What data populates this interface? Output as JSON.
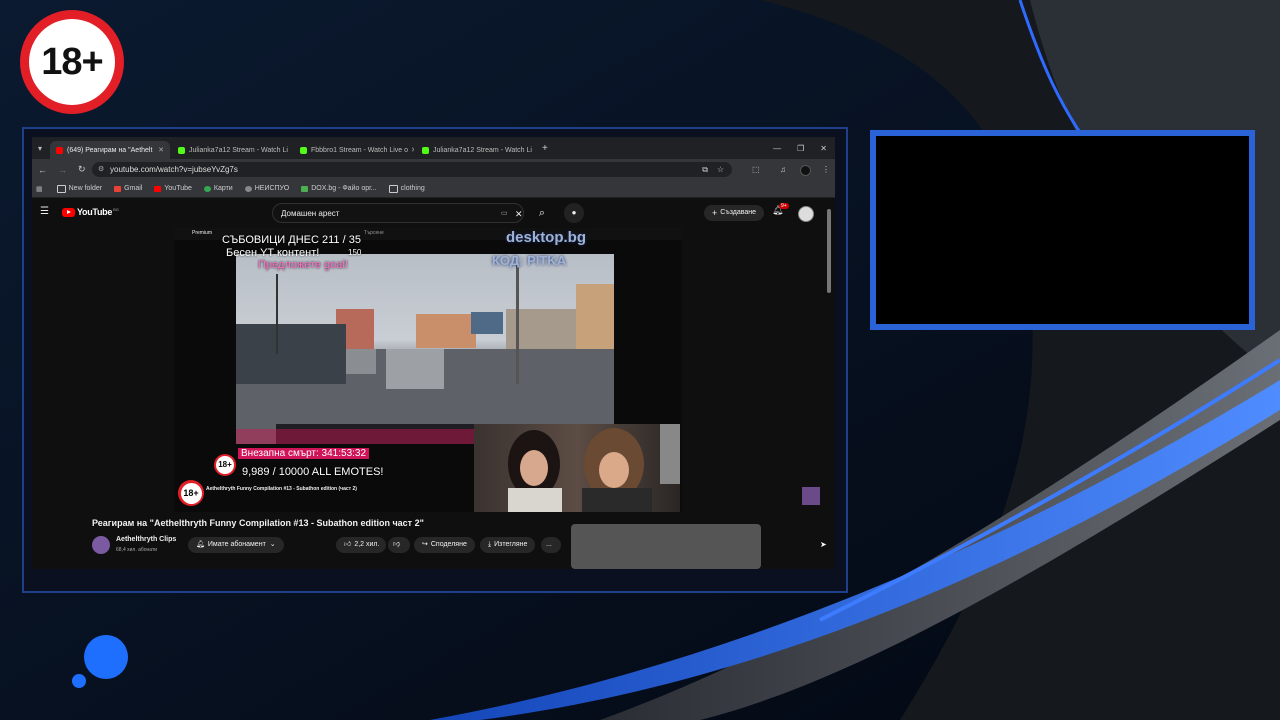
{
  "overlay": {
    "age_badge": "18+"
  },
  "browser": {
    "tabs": [
      {
        "label": "(649) Реагирам на \"Aethelt",
        "active": true,
        "color": "#ff0000"
      },
      {
        "label": "Julianka7a12 Stream - Watch Li",
        "active": false,
        "color": "#53fc18"
      },
      {
        "label": "Fbbbro1 Stream - Watch Live o",
        "active": false,
        "color": "#53fc18"
      },
      {
        "label": "Julianka7a12 Stream - Watch Li",
        "active": false,
        "color": "#53fc18"
      }
    ],
    "url": "youtube.com/watch?v=jubseYvZg7s",
    "bookmarks": [
      "New folder",
      "Gmail",
      "YouTube",
      "Карти",
      "НЕИСПУО",
      "DOX.bg - Файо орг...",
      "clothing"
    ]
  },
  "youtube": {
    "logo": "YouTube",
    "logo_region": "BG",
    "search_value": "Домашен арест",
    "create_label": "Създаване",
    "notif_count": "9+"
  },
  "player": {
    "inner_premium": "Premium",
    "inner_search": "Търсене",
    "overlay_line1": "СЪБОВИЦИ ДНЕС 211 / 35",
    "overlay_line2": "Бесен YT контент!",
    "overlay_line2b": "150",
    "overlay_line3": "Предложете goal!",
    "watermark1": "desktop.bg",
    "watermark2": "КОД: PITKA",
    "sudden_death": "Внезапна смърт: 341:53:32",
    "emotes": "9,989 / 10000 ALL EMOTES!",
    "badge": "18+",
    "inner_title": "Aethelthryth Funny Compilation #13 - Subathon edition (част 2)"
  },
  "video": {
    "title": "Реагирам на \"Aethelthryth Funny Compilation #13 - Subathon edition част 2\"",
    "channel": "Aethelthryth Clips",
    "subscribers": "68,4 хил. абонати",
    "subscribe_label": "Имате абонамент",
    "likes": "2,2 хил.",
    "share_label": "Споделяне",
    "download_label": "Изтегляне",
    "more_label": "..."
  },
  "colors": {
    "accent": "#2a62d8",
    "badge_red": "#e21f26",
    "overlay_pink": "#ff6fc8"
  }
}
